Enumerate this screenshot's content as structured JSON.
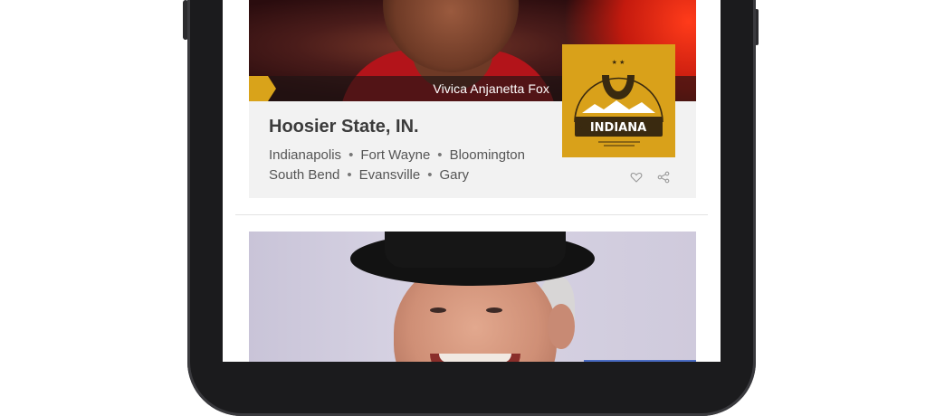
{
  "cards": [
    {
      "photo_caption": "Vivica Anjanetta Fox",
      "title": "Hoosier State, IN.",
      "city_rows": [
        [
          "Indianapolis",
          "Fort Wayne",
          "Bloomington"
        ],
        [
          "South Bend",
          "Evansville",
          "Gary"
        ]
      ],
      "badge_text": "INDIANA",
      "accent_color": "#d9a11a",
      "actions": [
        "heart-icon",
        "share-icon"
      ]
    }
  ],
  "colors": {
    "badge": "#d9a11a",
    "card_bg": "#f2f2f2",
    "title": "#3b3b3b",
    "text": "#555555"
  }
}
